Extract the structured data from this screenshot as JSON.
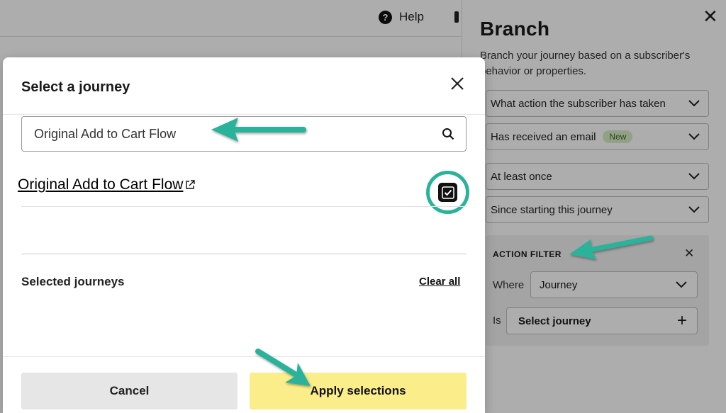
{
  "topbar": {
    "help_label": "Help"
  },
  "panel": {
    "title": "Branch",
    "description": "Branch your journey based on a subscriber's behavior or properties.",
    "dropdowns": [
      {
        "label": "What action the subscriber has taken"
      },
      {
        "label": "Has received an email",
        "badge": "New"
      },
      {
        "label": "At least once"
      },
      {
        "label": "Since starting this journey"
      }
    ],
    "filter": {
      "title": "ACTION FILTER",
      "where_label": "Where",
      "where_value": "Journey",
      "is_label": "Is",
      "select_label": "Select journey"
    }
  },
  "modal": {
    "title": "Select a journey",
    "search": {
      "value": "Original Add to Cart Flow"
    },
    "results": [
      {
        "label": "Original Add to Cart Flow",
        "checked": true
      }
    ],
    "selected_title": "Selected journeys",
    "clear_all": "Clear all",
    "cancel": "Cancel",
    "apply": "Apply selections"
  },
  "colors": {
    "annotation": "#2ab39a",
    "apply_button": "#fbed8a",
    "badge_bg": "#d7ecc5"
  }
}
